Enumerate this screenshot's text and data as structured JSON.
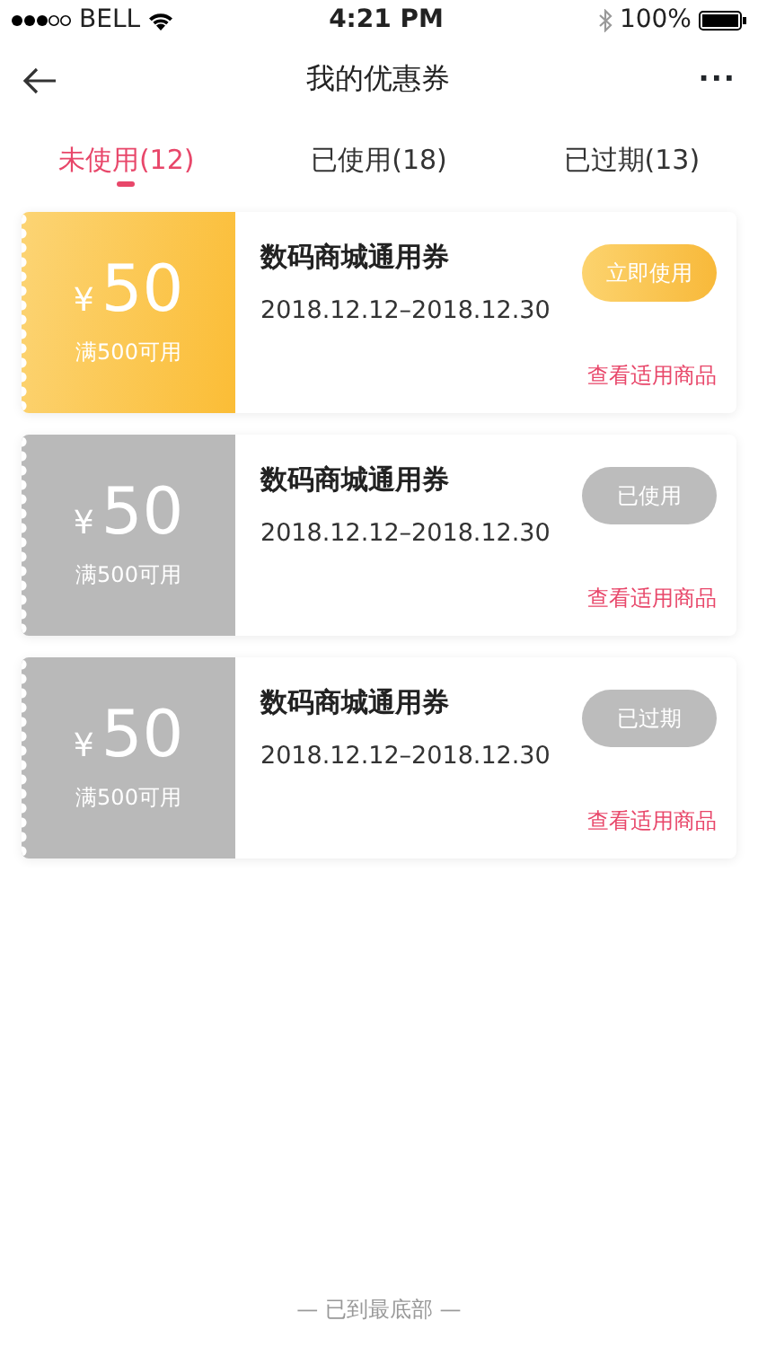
{
  "status_bar": {
    "carrier": "BELL",
    "time": "4:21 PM",
    "battery": "100%"
  },
  "header": {
    "title": "我的优惠券",
    "menu": "···"
  },
  "tabs": [
    {
      "label": "未使用(12)",
      "selected": true
    },
    {
      "label": "已使用(18)",
      "selected": false
    },
    {
      "label": "已过期(13)",
      "selected": false
    }
  ],
  "coupons": [
    {
      "kind": "available",
      "currency": "¥",
      "amount": "50",
      "condition": "满500可用",
      "title": "数码商城通用券",
      "period": "2018.12.12–2018.12.30",
      "action": "立即使用",
      "link": "查看适用商品"
    },
    {
      "kind": "used",
      "currency": "¥",
      "amount": "50",
      "condition": "满500可用",
      "title": "数码商城通用券",
      "period": "2018.12.12–2018.12.30",
      "action": "已使用",
      "link": "查看适用商品"
    },
    {
      "kind": "expired",
      "currency": "¥",
      "amount": "50",
      "condition": "满500可用",
      "title": "数码商城通用券",
      "period": "2018.12.12–2018.12.30",
      "action": "已过期",
      "link": "查看适用商品"
    }
  ],
  "footer": "— 已到最底部 —"
}
